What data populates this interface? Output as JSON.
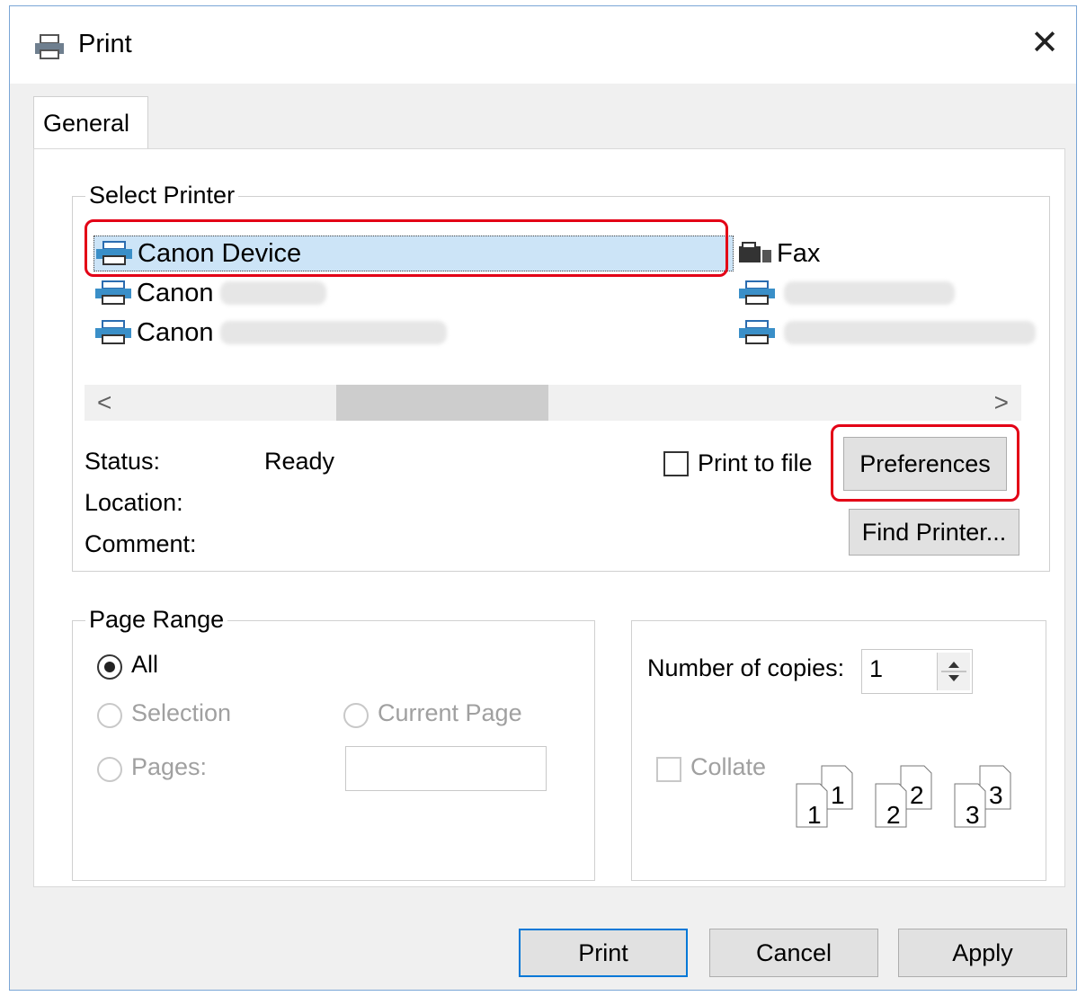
{
  "window": {
    "title": "Print",
    "close_symbol": "✕"
  },
  "tabs": [
    {
      "label": "General"
    }
  ],
  "select_printer": {
    "group_label": "Select Printer",
    "printers": [
      {
        "name": "Canon Device",
        "icon": "printer-icon",
        "selected": true
      },
      {
        "name": "Canon",
        "icon": "printer-icon",
        "blurred_suffix": true
      },
      {
        "name": "Canon",
        "icon": "printer-icon",
        "blurred_suffix": true
      },
      {
        "name": "Fax",
        "icon": "fax-icon"
      },
      {
        "name": "",
        "icon": "printer-icon",
        "blurred_suffix": true
      },
      {
        "name": "",
        "icon": "printer-icon",
        "blurred_suffix": true
      }
    ],
    "scroll_left": "<",
    "scroll_right": ">",
    "status_label": "Status:",
    "status_value": "Ready",
    "location_label": "Location:",
    "comment_label": "Comment:",
    "print_to_file_label": "Print to file",
    "print_to_file_checked": false,
    "preferences_button": "Preferences",
    "find_printer_button": "Find Printer..."
  },
  "page_range": {
    "group_label": "Page Range",
    "all_label": "All",
    "selection_label": "Selection",
    "current_page_label": "Current Page",
    "pages_label": "Pages:",
    "pages_value": "",
    "selected_option": "All"
  },
  "copies": {
    "number_of_copies_label": "Number of copies:",
    "number_of_copies_value": "1",
    "collate_label": "Collate",
    "collate_checked": false,
    "collate_pages": [
      "1",
      "1",
      "2",
      "2",
      "3",
      "3"
    ]
  },
  "buttons": {
    "print": "Print",
    "cancel": "Cancel",
    "apply": "Apply"
  },
  "colors": {
    "highlight": "#e30016",
    "selection": "#cce4f7",
    "primary_border": "#0078d7"
  }
}
